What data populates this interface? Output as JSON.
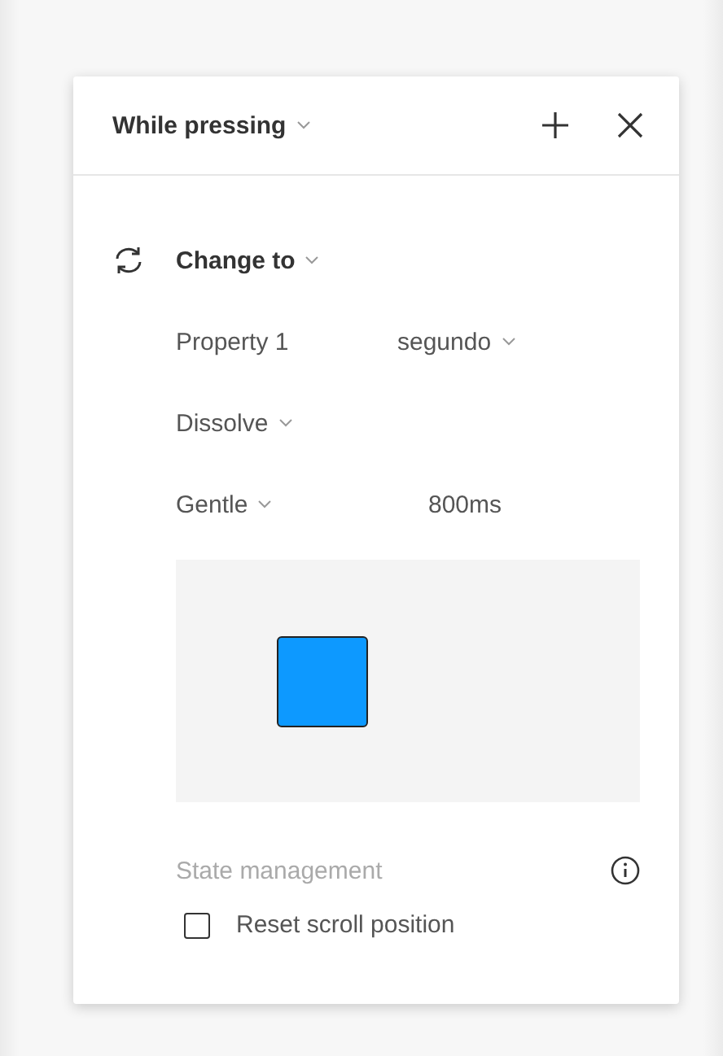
{
  "header": {
    "trigger": "While pressing"
  },
  "action": {
    "label": "Change to"
  },
  "property": {
    "name": "Property 1",
    "value": "segundo"
  },
  "animation": {
    "label": "Dissolve"
  },
  "easing": {
    "label": "Gentle",
    "duration": "800ms"
  },
  "preview": {
    "color": "#0d99ff"
  },
  "state_management": {
    "label": "State management"
  },
  "reset_scroll": {
    "label": "Reset scroll position",
    "checked": false
  }
}
